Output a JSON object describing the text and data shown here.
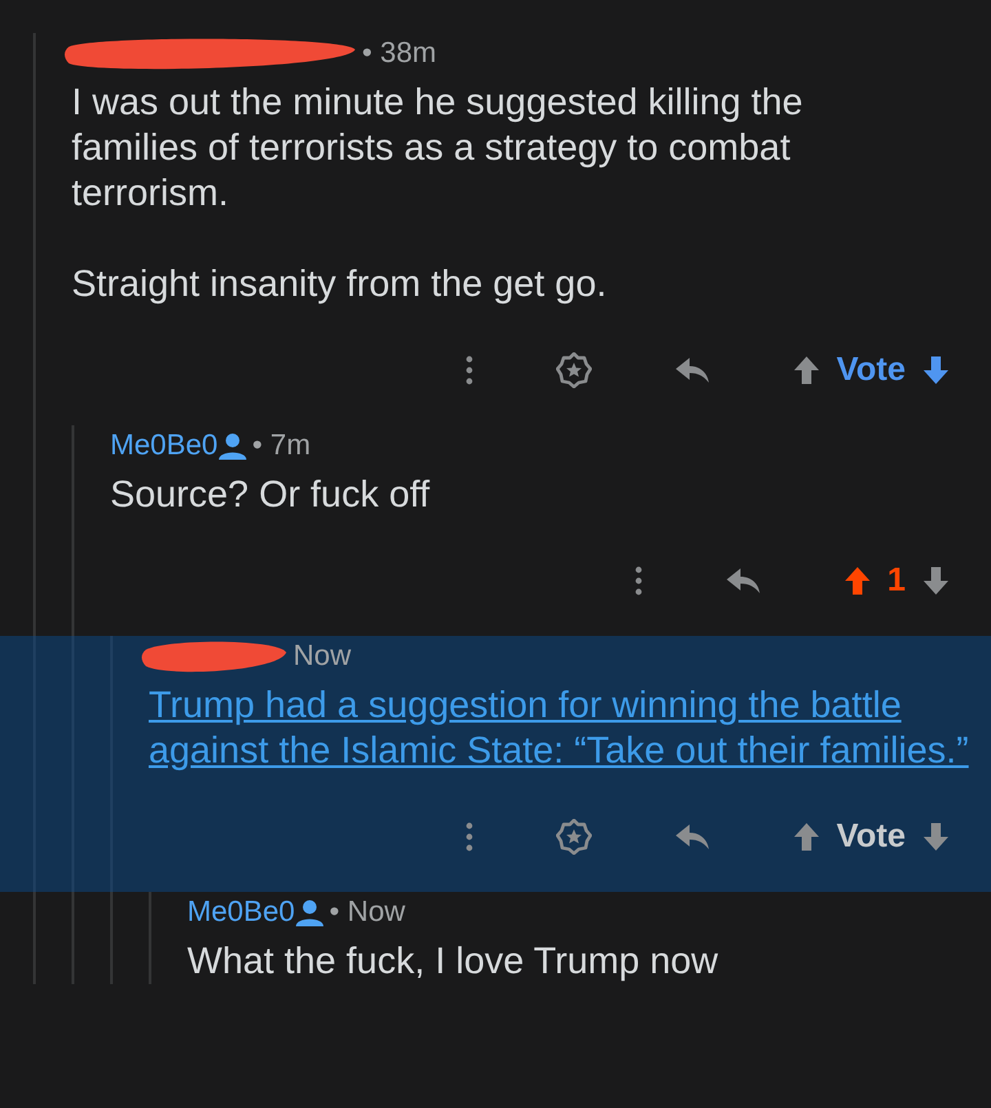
{
  "thread": [
    {
      "redacted": true,
      "time": "• 38m",
      "highlighted": false,
      "kind": "text",
      "paragraphs": [
        "I was out the minute he suggested killing the families of terrorists as a strategy to combat terrorism.",
        "Straight insanity from the get go."
      ],
      "actions": {
        "award": true,
        "vote_label": "Vote",
        "upvoted": false,
        "downvoted": true
      },
      "children": [
        {
          "redacted": false,
          "author": "Me0Be0",
          "time": "• 7m",
          "highlighted": false,
          "kind": "text",
          "paragraphs": [
            "Source? Or fuck off"
          ],
          "actions": {
            "award": false,
            "vote_label": "1",
            "upvoted": true,
            "downvoted": false
          },
          "children": [
            {
              "redacted": true,
              "time": "Now",
              "highlighted": true,
              "kind": "link",
              "paragraphs": [
                "Trump had a suggestion for winning the battle against the Islamic State: “Take out their families.”"
              ],
              "actions": {
                "award": true,
                "vote_label": "Vote",
                "upvoted": false,
                "downvoted": false
              },
              "children": [
                {
                  "redacted": false,
                  "author": "Me0Be0",
                  "time": "• Now",
                  "highlighted": false,
                  "kind": "text",
                  "paragraphs": [
                    "What the fuck, I love Trump now"
                  ]
                }
              ]
            }
          ]
        }
      ]
    }
  ]
}
